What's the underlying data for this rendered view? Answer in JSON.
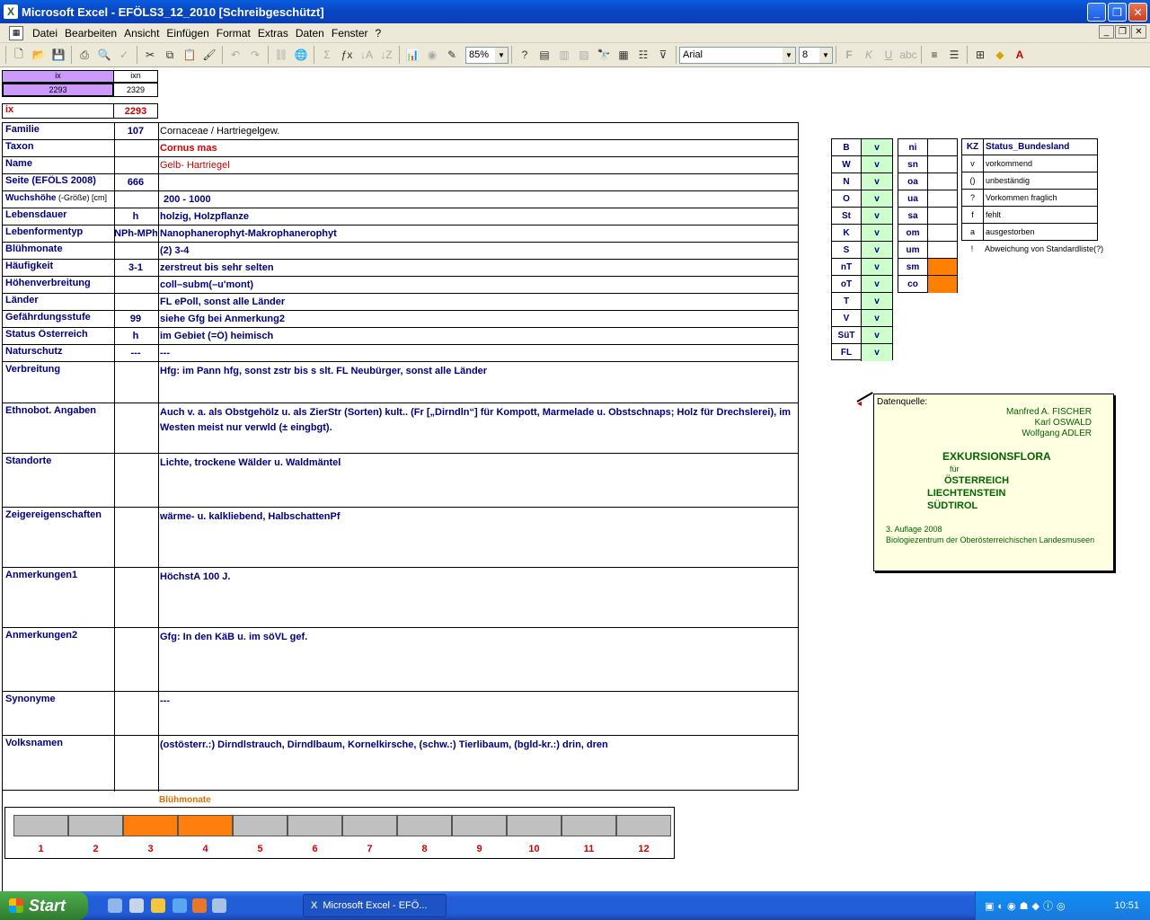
{
  "window": {
    "title": "Microsoft Excel - EFÖLS3_12_2010  [Schreibgeschützt]",
    "min": "_",
    "max": "❐",
    "close": "✕"
  },
  "menu": [
    "Datei",
    "Bearbeiten",
    "Ansicht",
    "Einfügen",
    "Format",
    "Extras",
    "Daten",
    "Fenster",
    "?"
  ],
  "toolbar": {
    "zoom": "85%",
    "font": "Arial",
    "size": "8"
  },
  "index": {
    "ix_label": "ix",
    "ixn_label": "ixn",
    "ix_value": "2293",
    "ixn_value": "2329",
    "ix_row_label": "ix",
    "ix_row_value": "2293"
  },
  "rows": [
    {
      "label": "Familie",
      "code": "107",
      "text": "Cornaceae  /  Hartriegelgew."
    },
    {
      "label": "Taxon",
      "code": "",
      "text": "Cornus mas"
    },
    {
      "label": "Name",
      "code": "",
      "text": "Gelb- Hartriegel"
    },
    {
      "label": "Seite (EFÖLS 2008)",
      "code": "666",
      "text": ""
    },
    {
      "label": "Wuchshöhe",
      "label_suffix": "(-Größe) [cm]",
      "code": "",
      "text": "200 - 1000"
    },
    {
      "label": "Lebensdauer",
      "code": "h",
      "text": "holzig, Holzpflanze"
    },
    {
      "label": "Lebenformentyp",
      "code": "NPh-MPh",
      "text": "Nanophanerophyt-Makrophanerophyt"
    },
    {
      "label": "Blühmonate",
      "code": "",
      "text": "(2) 3-4"
    },
    {
      "label": "Häufigkeit",
      "code": "3-1",
      "text": "zerstreut bis sehr selten"
    },
    {
      "label": "Höhenverbreitung",
      "code": "",
      "text": "coll–subm(–u'mont)"
    },
    {
      "label": "Länder",
      "code": "",
      "text": "FL ePoll, sonst alle Länder"
    },
    {
      "label": "Gefährdungsstufe",
      "code": "99",
      "text": "siehe Gfg bei Anmerkung2"
    },
    {
      "label": "Status Österreich",
      "code": "h",
      "text": "im Gebiet (=Ö) heimisch"
    },
    {
      "label": "Naturschutz",
      "code": "---",
      "text": "---"
    }
  ],
  "big_rows": [
    {
      "label": "Verbreitung",
      "text": "Hfg: im Pann hfg, sonst zstr bis s slt. FL Neubürger, sonst alle Länder"
    },
    {
      "label": "Ethnobot. Angaben",
      "text": "Auch v. a. als Obstgehölz u. als ZierStr (Sorten) kult.. (Fr [„Dirndln“] für Kompott, Marmelade u. Obstschnaps; Holz für Drechslerei), im Westen meist nur verwld (± eingbgt)."
    },
    {
      "label": "Standorte",
      "text": "Lichte, trockene Wälder u. Waldmäntel"
    },
    {
      "label": "Zeigereigenschaften",
      "text": "wärme- u. kalkliebend, HalbschattenPf"
    },
    {
      "label": "Anmerkungen1",
      "text": "HöchstA 100 J."
    },
    {
      "label": "Anmerkungen2",
      "text": "Gfg:  In den KäB u. im söVL gef."
    },
    {
      "label": "Synonyme",
      "text": "---"
    },
    {
      "label": "Volksnamen",
      "text": "(ostösterr.:) Dirndlstrauch, Dirndlbaum,  Kornelkirsche, (schw.:) Tierlibaum, (bgld-kr.:) drin, dren"
    }
  ],
  "laender": [
    {
      "code": "B",
      "v": "v"
    },
    {
      "code": "W",
      "v": "v"
    },
    {
      "code": "N",
      "v": "v"
    },
    {
      "code": "O",
      "v": "v"
    },
    {
      "code": "St",
      "v": "v"
    },
    {
      "code": "K",
      "v": "v"
    },
    {
      "code": "S",
      "v": "v"
    },
    {
      "code": "nT",
      "v": "v"
    },
    {
      "code": "oT",
      "v": "v"
    },
    {
      "code": "T",
      "v": "v"
    },
    {
      "code": "V",
      "v": "v"
    },
    {
      "code": "SüT",
      "v": "v"
    },
    {
      "code": "FL",
      "v": "v"
    }
  ],
  "regions": [
    {
      "code": "ni",
      "fill": false
    },
    {
      "code": "sn",
      "fill": false
    },
    {
      "code": "oa",
      "fill": false
    },
    {
      "code": "ua",
      "fill": false
    },
    {
      "code": "sa",
      "fill": false
    },
    {
      "code": "om",
      "fill": false
    },
    {
      "code": "um",
      "fill": false
    },
    {
      "code": "sm",
      "fill": true
    },
    {
      "code": "co",
      "fill": true
    }
  ],
  "status_legend": {
    "kz": "KZ",
    "title": "Status_Bundesland",
    "items": [
      {
        "k": "v",
        "t": "vorkommend"
      },
      {
        "k": "()",
        "t": "unbeständig"
      },
      {
        "k": "?",
        "t": "Vorkommen fraglich"
      },
      {
        "k": "f",
        "t": "fehlt"
      },
      {
        "k": "a",
        "t": "ausgestorben"
      },
      {
        "k": "!",
        "t": "Abweichung von Standardliste(?)"
      }
    ]
  },
  "comment": {
    "label": "Datenquelle:",
    "authors": [
      "Manfred A. FISCHER",
      "Karl OSWALD",
      "Wolfgang ADLER"
    ],
    "title": "EXKURSIONSFLORA",
    "fuer": "für",
    "countries": [
      "ÖSTERREICH",
      "LIECHTENSTEIN",
      "SÜDTIROL"
    ],
    "edition": "3. Auflage 2008",
    "publisher": "Biologiezentrum der Oberösterreichischen Landesmuseen"
  },
  "bloom": {
    "title": "Blühmonate",
    "months": [
      "1",
      "2",
      "3",
      "4",
      "5",
      "6",
      "7",
      "8",
      "9",
      "10",
      "11",
      "12"
    ],
    "active": [
      3,
      4
    ]
  },
  "taskbar": {
    "start": "Start",
    "task": "Microsoft Excel - EFÖ...",
    "time": "10:51"
  }
}
